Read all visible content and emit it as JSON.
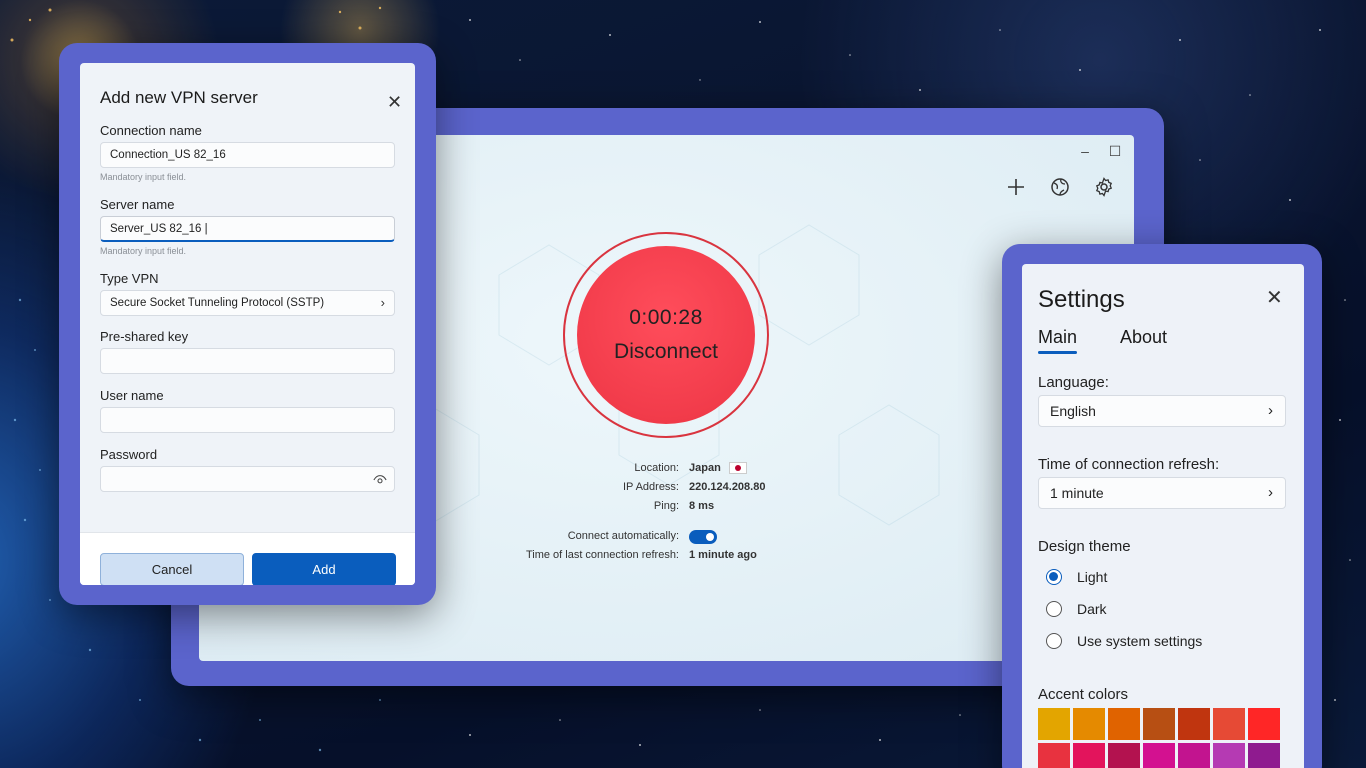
{
  "main": {
    "timer": "0:00:28",
    "disconnect_label": "Disconnect",
    "location_label": "Location:",
    "location_value": "Japan",
    "ip_label": "IP Address:",
    "ip_value": "220.124.208.80",
    "ping_label": "Ping:",
    "ping_value": "8 ms",
    "auto_label": "Connect automatically:",
    "auto_on": true,
    "refresh_label": "Time of last connection refresh:",
    "refresh_value": "1 minute ago",
    "window_controls": [
      "–",
      "☐",
      "✕"
    ]
  },
  "add_dialog": {
    "title": "Add new VPN server",
    "connection_name_label": "Connection name",
    "connection_name_value": "Connection_US 82_16",
    "mandatory_hint": "Mandatory input field.",
    "server_name_label": "Server name",
    "server_name_value": "Server_US 82_16 |",
    "type_label": "Type VPN",
    "type_value": "Secure Socket Tunneling Protocol (SSTP)",
    "psk_label": "Pre-shared key",
    "psk_value": "",
    "user_label": "User name",
    "user_value": "",
    "password_label": "Password",
    "password_value": "",
    "cancel_label": "Cancel",
    "add_label": "Add"
  },
  "settings": {
    "title": "Settings",
    "tabs": [
      {
        "label": "Main",
        "active": true
      },
      {
        "label": "About",
        "active": false
      }
    ],
    "language_label": "Language:",
    "language_value": "English",
    "refresh_label": "Time of connection refresh:",
    "refresh_value": "1 minute",
    "theme_heading": "Design theme",
    "themes": [
      {
        "label": "Light",
        "checked": true
      },
      {
        "label": "Dark",
        "checked": false
      },
      {
        "label": "Use system settings",
        "checked": false
      }
    ],
    "accent_heading": "Accent colors",
    "accent_colors": [
      "#e3a500",
      "#e58a00",
      "#e06300",
      "#b74f13",
      "#c0350f",
      "#e64a35",
      "#ff2626",
      "#e8323f",
      "#e3145c",
      "#b3124f",
      "#d31190",
      "#c2148f",
      "#b53ab3",
      "#8f1b8f"
    ]
  }
}
